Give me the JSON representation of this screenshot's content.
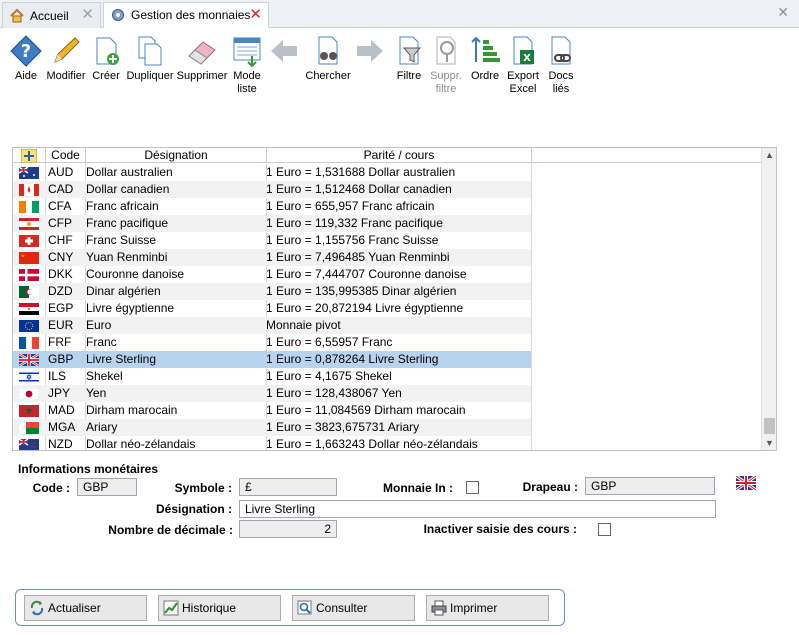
{
  "tabs": [
    {
      "label": "Accueil",
      "icon": "home-icon"
    },
    {
      "label": "Gestion des monnaies",
      "icon": "gear-icon",
      "active": true
    }
  ],
  "toolbar": {
    "aide": "Aide",
    "modifier": "Modifier",
    "creer": "Créer",
    "dupliquer": "Dupliquer",
    "supprimer": "Supprimer",
    "mode_liste_1": "Mode",
    "mode_liste_2": "liste",
    "chercher": "Chercher",
    "filtre": "Filtre",
    "suppr_filtre_1": "Suppr.",
    "suppr_filtre_2": "filtre",
    "ordre": "Ordre",
    "export_1": "Export",
    "export_2": "Excel",
    "docs_1": "Docs",
    "docs_2": "liés"
  },
  "grid": {
    "headers": {
      "code": "Code",
      "designation": "Désignation",
      "parite": "Parité / cours"
    },
    "rows": [
      {
        "code": "AUD",
        "designation": "Dollar australien",
        "parite": "1 Euro = 1,531688 Dollar australien",
        "flag": "au"
      },
      {
        "code": "CAD",
        "designation": "Dollar canadien",
        "parite": "1 Euro = 1,512468 Dollar canadien",
        "flag": "ca"
      },
      {
        "code": "CFA",
        "designation": "Franc africain",
        "parite": "1 Euro = 655,957 Franc africain",
        "flag": "ci"
      },
      {
        "code": "CFP",
        "designation": "Franc pacifique",
        "parite": "1 Euro = 119,332 Franc pacifique",
        "flag": "pf"
      },
      {
        "code": "CHF",
        "designation": "Franc Suisse",
        "parite": "1 Euro = 1,155756 Franc Suisse",
        "flag": "ch"
      },
      {
        "code": "CNY",
        "designation": "Yuan Renminbi",
        "parite": "1 Euro = 7,496485 Yuan Renminbi",
        "flag": "cn"
      },
      {
        "code": "DKK",
        "designation": "Couronne danoise",
        "parite": "1 Euro = 7,444707 Couronne danoise",
        "flag": "dk"
      },
      {
        "code": "DZD",
        "designation": "Dinar algérien",
        "parite": "1 Euro = 135,995385 Dinar algérien",
        "flag": "dz"
      },
      {
        "code": "EGP",
        "designation": "Livre égyptienne",
        "parite": "1 Euro = 20,872194 Livre égyptienne",
        "flag": "eg"
      },
      {
        "code": "EUR",
        "designation": "Euro",
        "parite": "Monnaie pivot",
        "flag": "eu"
      },
      {
        "code": "FRF",
        "designation": "Franc",
        "parite": "1 Euro = 6,55957 Franc",
        "flag": "fr"
      },
      {
        "code": "GBP",
        "designation": "Livre Sterling",
        "parite": "1 Euro = 0,878264 Livre Sterling",
        "flag": "gb",
        "selected": true
      },
      {
        "code": "ILS",
        "designation": "Shekel",
        "parite": "1 Euro = 4,1675 Shekel",
        "flag": "il"
      },
      {
        "code": "JPY",
        "designation": "Yen",
        "parite": "1 Euro = 128,438067 Yen",
        "flag": "jp"
      },
      {
        "code": "MAD",
        "designation": "Dirham marocain",
        "parite": "1 Euro = 11,084569 Dirham marocain",
        "flag": "ma"
      },
      {
        "code": "MGA",
        "designation": "Ariary",
        "parite": "1 Euro = 3823,675731 Ariary",
        "flag": "mg"
      },
      {
        "code": "NZD",
        "designation": "Dollar néo-zélandais",
        "parite": "1 Euro = 1,663243 Dollar néo-zélandais",
        "flag": "nz"
      }
    ]
  },
  "form": {
    "section_title": "Informations monétaires",
    "code_label": "Code :",
    "code_value": "GBP",
    "symbole_label": "Symbole :",
    "symbole_value": "£",
    "monnaie_in_label": "Monnaie In :",
    "drapeau_label": "Drapeau :",
    "drapeau_value": "GBP",
    "designation_label": "Désignation :",
    "designation_value": "Livre Sterling",
    "decimale_label": "Nombre de décimale :",
    "decimale_value": "2",
    "inactiver_label": "Inactiver saisie des cours :"
  },
  "buttons": {
    "actualiser": "Actualiser",
    "historique": "Historique",
    "consulter": "Consulter",
    "imprimer": "Imprimer"
  },
  "colors": {
    "selected_row": "#b7d3ee",
    "alt_row": "#f2f2f2",
    "close_red": "#d8232a"
  }
}
